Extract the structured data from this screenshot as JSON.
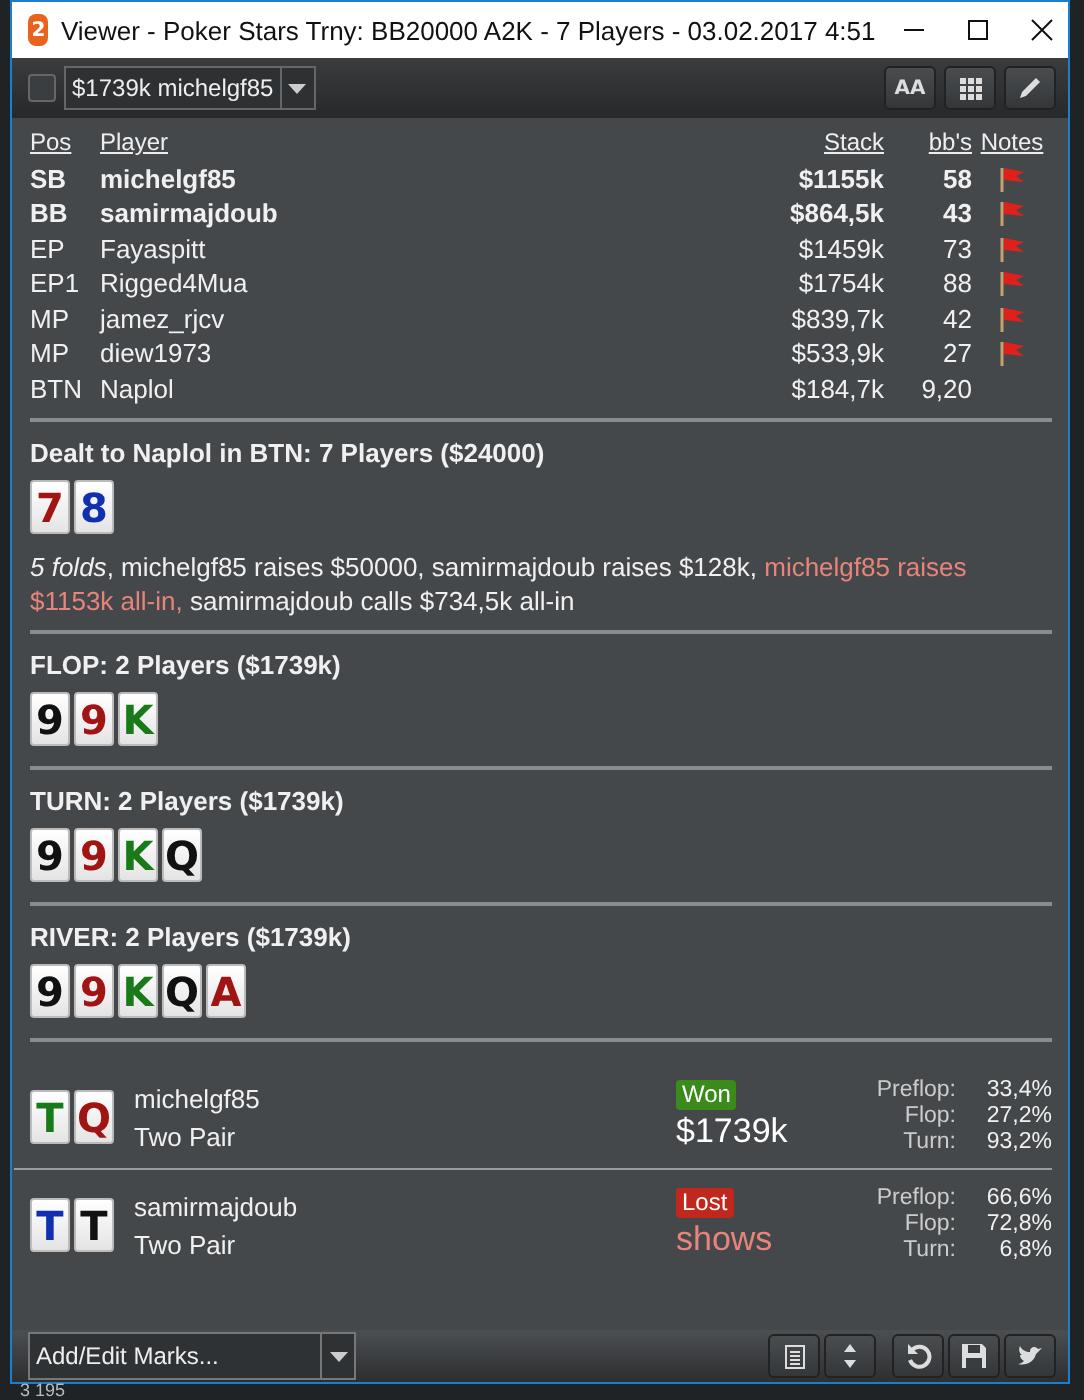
{
  "window": {
    "app_badge": "2",
    "title": "Viewer - Poker Stars Trny: BB20000 A2K - 7 Players - 03.02.2017 4:51"
  },
  "toolbar": {
    "checkbox": {
      "checked": false
    },
    "hand_select": {
      "value": "$1739k michelgf85"
    },
    "font_button_label": "AA"
  },
  "table": {
    "columns": [
      "Pos",
      "Player",
      "Stack",
      "bb's",
      "Notes"
    ],
    "rows": [
      {
        "pos": "SB",
        "player": "michelgf85",
        "stack": "$1155k",
        "bbs": "58",
        "in_hand": true,
        "flagged": true
      },
      {
        "pos": "BB",
        "player": "samirmajdoub",
        "stack": "$864,5k",
        "bbs": "43",
        "in_hand": true,
        "flagged": true
      },
      {
        "pos": "EP",
        "player": "Fayaspitt",
        "stack": "$1459k",
        "bbs": "73",
        "in_hand": false,
        "flagged": true
      },
      {
        "pos": "EP1",
        "player": "Rigged4Mua",
        "stack": "$1754k",
        "bbs": "88",
        "in_hand": false,
        "flagged": true
      },
      {
        "pos": "MP",
        "player": "jamez_rjcv",
        "stack": "$839,7k",
        "bbs": "42",
        "in_hand": false,
        "flagged": true
      },
      {
        "pos": "MP",
        "player": "diew1973",
        "stack": "$533,9k",
        "bbs": "27",
        "in_hand": false,
        "flagged": true
      },
      {
        "pos": "BTN",
        "player": "Naplol",
        "stack": "$184,7k",
        "bbs": "9,20",
        "in_hand": false,
        "flagged": false
      }
    ]
  },
  "preflop": {
    "heading": "Dealt to Naplol in BTN: 7 Players ($24000)",
    "cards": [
      {
        "rank": "7",
        "color": "#a01414"
      },
      {
        "rank": "8",
        "color": "#1030b0"
      }
    ],
    "actions": [
      {
        "text": "*5 folds*, michelgf85 raises $50000, samirmajdoub raises $128k, ",
        "highlight": false
      },
      {
        "text": "michelgf85 raises $1153k all-in,",
        "highlight": true
      },
      {
        "text": " samirmajdoub calls $734,5k all-in",
        "highlight": false
      }
    ]
  },
  "streets": [
    {
      "heading": "FLOP: 2 Players ($1739k)",
      "cards": [
        {
          "rank": "9",
          "color": "#111111"
        },
        {
          "rank": "9",
          "color": "#a01414"
        },
        {
          "rank": "K",
          "color": "#1a7a1a"
        }
      ]
    },
    {
      "heading": "TURN: 2 Players ($1739k)",
      "cards": [
        {
          "rank": "9",
          "color": "#111111"
        },
        {
          "rank": "9",
          "color": "#a01414"
        },
        {
          "rank": "K",
          "color": "#1a7a1a"
        },
        {
          "rank": "Q",
          "color": "#111111"
        }
      ]
    },
    {
      "heading": "RIVER: 2 Players ($1739k)",
      "cards": [
        {
          "rank": "9",
          "color": "#111111"
        },
        {
          "rank": "9",
          "color": "#a01414"
        },
        {
          "rank": "K",
          "color": "#1a7a1a"
        },
        {
          "rank": "Q",
          "color": "#111111"
        },
        {
          "rank": "A",
          "color": "#a01414"
        }
      ]
    }
  ],
  "showdown": [
    {
      "cards": [
        {
          "rank": "T",
          "color": "#1a7a1a"
        },
        {
          "rank": "Q",
          "color": "#a01414"
        }
      ],
      "player": "michelgf85",
      "hand": "Two Pair",
      "result": {
        "kind": "won",
        "label": "Won"
      },
      "amount": "$1739k",
      "equity": [
        {
          "street": "Preflop:",
          "value": "33,4%"
        },
        {
          "street": "Flop:",
          "value": "27,2%"
        },
        {
          "street": "Turn:",
          "value": "93,2%"
        }
      ]
    },
    {
      "cards": [
        {
          "rank": "T",
          "color": "#1030b0"
        },
        {
          "rank": "T",
          "color": "#111111"
        }
      ],
      "player": "samirmajdoub",
      "hand": "Two Pair",
      "result": {
        "kind": "lost",
        "label": "Lost"
      },
      "amount": "shows",
      "equity": [
        {
          "street": "Preflop:",
          "value": "66,6%"
        },
        {
          "street": "Flop:",
          "value": "72,8%"
        },
        {
          "street": "Turn:",
          "value": "6,8%"
        }
      ]
    }
  ],
  "bottom_bar": {
    "marks_select": {
      "value": "Add/Edit Marks..."
    }
  },
  "background_text": "3 195"
}
